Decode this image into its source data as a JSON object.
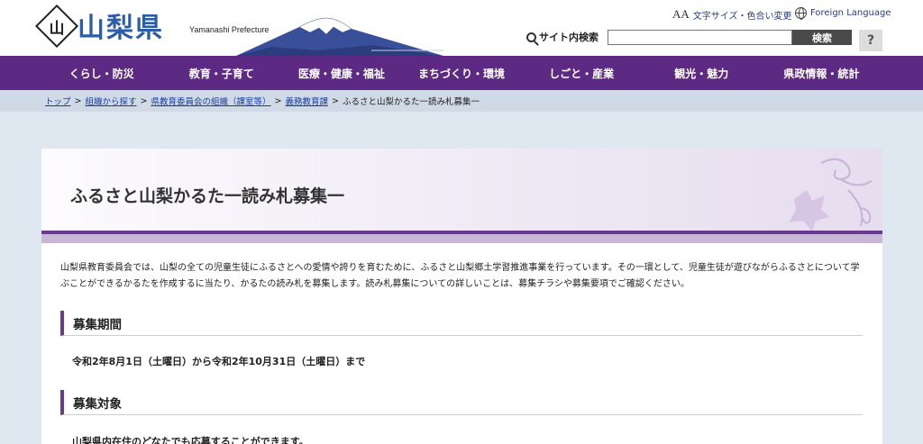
{
  "header": {
    "seal_glyph": "山",
    "logo_text": "山梨県",
    "logo_sub": "Yamanashi Prefecture",
    "font_size_link": "文字サイズ・色合い変更",
    "font_size_glyph": "AA",
    "foreign_language": "Foreign Language",
    "search_label": "サイト内検索",
    "search_value": "",
    "search_button": "検索",
    "help_button": "?"
  },
  "nav": {
    "items": [
      "くらし・防災",
      "教育・子育て",
      "医療・健康・福祉",
      "まちづくり・環境",
      "しごと・産業",
      "観光・魅力",
      "県政情報・統計"
    ]
  },
  "breadcrumb": {
    "items": [
      "トップ",
      "組織から探す",
      "県教育委員会の組織（課室等）",
      "義務教育課"
    ],
    "current": "ふるさと山梨かるた一読み札募集一",
    "separator": ">"
  },
  "main": {
    "title": "ふるさと山梨かるた一読み札募集一",
    "intro": "山梨県教育委員会では、山梨の全ての児童生徒にふるさとへの愛情や誇りを育むために、ふるさと山梨郷土学習推進事業を行っています。その一環として、児童生徒が遊びながらふるさとについて学ぶことができるかるたを作成するに当たり、かるたの読み札を募集します。読み札募集についての詳しいことは、募集チラシや募集要項でご確認ください。",
    "sections": [
      {
        "heading": "募集期間",
        "text": "令和2年8月1日（土曜日）から令和2年10月31日（土曜日）まで"
      },
      {
        "heading": "募集対象",
        "text": "山梨県内在住のどなたでも応募することができます。"
      }
    ]
  },
  "colors": {
    "nav_bg": "#5c2a82",
    "accent": "#6a3a8e",
    "page_bg": "#dfe7f1",
    "breadcrumb_bg": "#cfdae6"
  }
}
